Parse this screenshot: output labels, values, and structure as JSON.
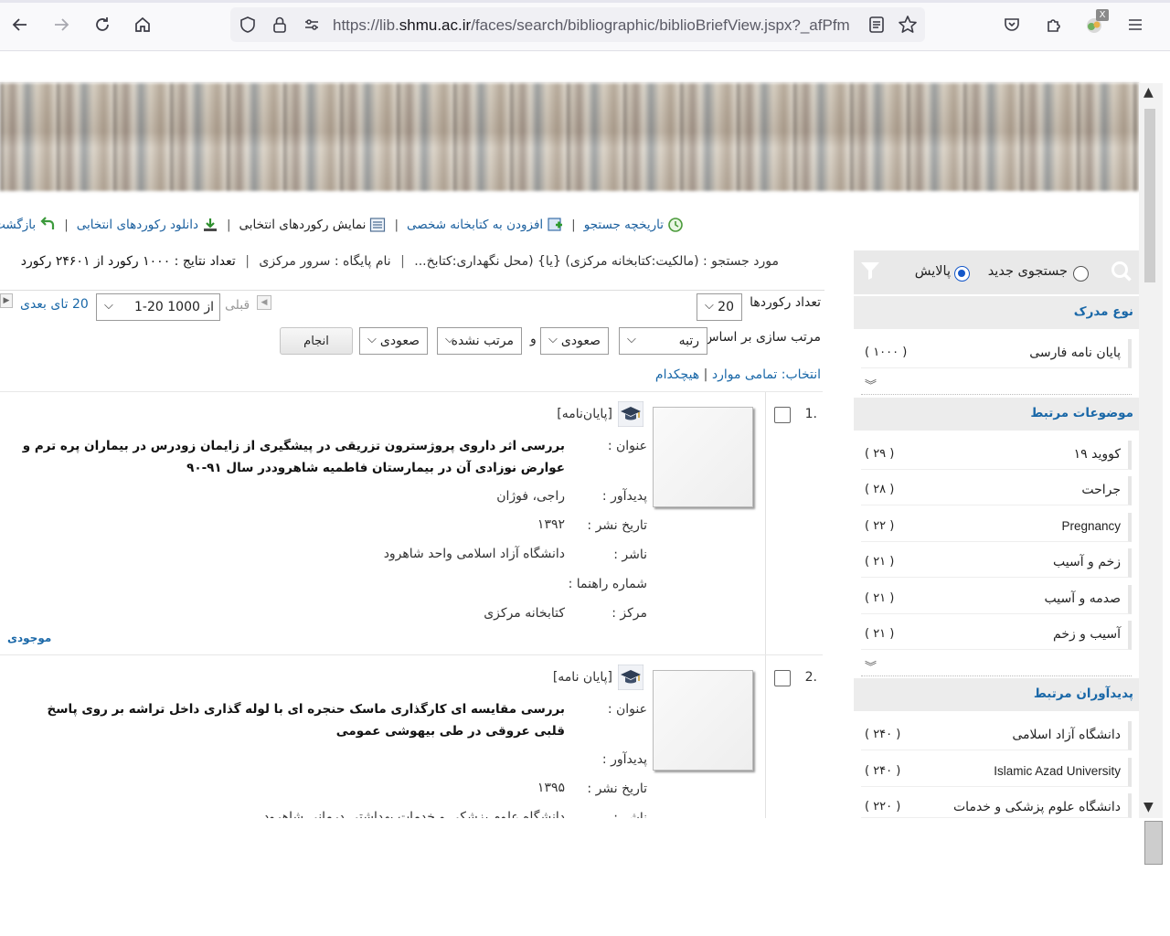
{
  "browser": {
    "url_prefix": "https://lib.",
    "url_host": "shmu.ac.ir",
    "url_path": "/faces/search/bibliographic/biblioBriefView.jspx?_afPfm",
    "extension_badge": "X"
  },
  "toolbar": {
    "history": "تاریخچه جستجو",
    "add_to_library": "افزودن به کتابخانه شخصی",
    "show_selected": "نمایش رکوردهای انتخابی",
    "download_selected": "دانلود رکوردهای انتخابی",
    "back": "بازگشت"
  },
  "search_info": {
    "query_label": "مورد جستجو :",
    "query_value": "(مالکیت:کتابخانه مرکزی) {یا} (محل نگهداری:کتابخ...",
    "db_label": "نام پایگاه :",
    "db_value": "سرور مرکزی",
    "results_label": "تعداد نتایج :",
    "results_value": "۱۰۰۰ رکورد از ۲۴۶۰۱ رکورد"
  },
  "controls": {
    "records_count_label": "تعداد رکوردها",
    "records_count_value": "20",
    "page_range_value": "1-20 از 1000",
    "prev_label": "قبلی",
    "next_label": "20 تای بعدی",
    "sort_label": "مرتب سازی بر اساس",
    "sort1_value": "رتبه",
    "sort1_order": "صعودی",
    "and_label": "و",
    "sort2_value": "مرتب نشده",
    "sort2_order": "صعودی",
    "apply_button": "انجام",
    "select_label": "انتخاب:",
    "select_all": "تمامی موارد",
    "select_sep": "|",
    "select_none": "هیچکدام"
  },
  "records": [
    {
      "number": "1.",
      "type": "[پایان‌نامه]",
      "title_label": "عنوان :",
      "title": "بررسی اثر داروی پروژسترون تزریقی در پیشگیری از زایمان زودرس در بیماران پره ترم و عوارض نوزادی آن در بیمارستان فاطمیه شاهرود‌در سال ۹۱-۹۰",
      "author_label": "پدیدآور :",
      "author": "راجی، فوژان",
      "date_label": "تاریخ نشر :",
      "date": "۱۳۹۲",
      "publisher_label": "ناشر :",
      "publisher": "دانشگاه آزاد اسلامی واحد شاهرود",
      "callno_label": "شماره راهنما :",
      "center_label": "مرکز :",
      "center": "کتابخانه مرکزی",
      "availability": "موجودی"
    },
    {
      "number": "2.",
      "type": "[پایان نامه]",
      "title_label": "عنوان :",
      "title": "بررسی مقایسه ای کارگذاری ماسک حنجره ای با لوله گذاری داخل تراشه بر روی پاسخ قلبی عروقی در طی بیهوشی عمومی",
      "author_label": "پدیدآور :",
      "date_label": "تاریخ نشر :",
      "date": "۱۳۹۵",
      "publisher_label": "ناشر :",
      "publisher": "دانشگاه علوم پزشکی و خدمات بهداشتی درمانی شاهرود"
    }
  ],
  "facets": {
    "new_search_label": "جستجوی جدید",
    "refine_label": "پالایش",
    "sections": [
      {
        "title": "نوع مدرک",
        "items": [
          {
            "name": "پایان نامه فارسی",
            "count": "( ۱۰۰۰ )"
          }
        ]
      },
      {
        "title": "موضوعات مرتبط",
        "items": [
          {
            "name": "کووید ۱۹",
            "count": "( ۲۹ )"
          },
          {
            "name": "جراحت",
            "count": "( ۲۸ )"
          },
          {
            "name": "Pregnancy",
            "count": "( ۲۲ )"
          },
          {
            "name": "زخم و آسیب",
            "count": "( ۲۱ )"
          },
          {
            "name": "صدمه و آسیب",
            "count": "( ۲۱ )"
          },
          {
            "name": "آسیب و زخم",
            "count": "( ۲۱ )"
          }
        ]
      },
      {
        "title": "پدیدآوران مرتبط",
        "items": [
          {
            "name": "دانشگاه آزاد اسلامی",
            "count": "( ۲۴۰ )"
          },
          {
            "name": "Islamic Azad University",
            "count": "( ۲۴۰ )"
          },
          {
            "name": "دانشگاه علوم پزشکی و خدمات",
            "count": "( ۲۲۰ )"
          }
        ]
      }
    ]
  },
  "icons": {
    "back": "arrow-left-icon",
    "forward": "arrow-right-icon",
    "reload": "reload-icon",
    "home": "home-icon",
    "shield": "shield-icon",
    "lock": "lock-icon",
    "permissions": "sliders-icon",
    "reader": "reader-view-icon",
    "bookmark": "star-icon",
    "pocket": "pocket-icon",
    "extensions": "puzzle-icon",
    "menu": "hamburger-menu-icon",
    "search": "magnifier-icon",
    "filter": "funnel-icon",
    "thesis": "graduation-cap-icon"
  },
  "colors": {
    "link_blue": "#1a68a8",
    "facet_bg": "#ececec",
    "radio_blue": "#1357c9"
  }
}
